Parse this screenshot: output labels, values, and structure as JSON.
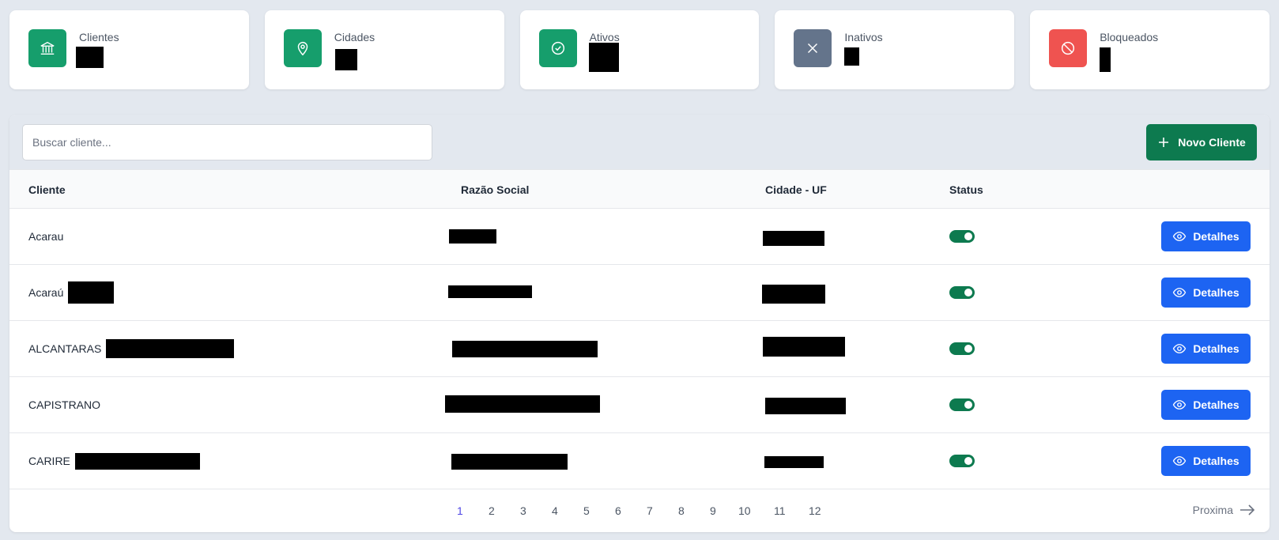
{
  "stats": [
    {
      "label": "Clientes",
      "icon": "bank-icon",
      "color": "#169e6c"
    },
    {
      "label": "Cidades",
      "icon": "map-pin-icon",
      "color": "#169e6c"
    },
    {
      "label": "Ativos",
      "icon": "check-circle-icon",
      "color": "#169e6c"
    },
    {
      "label": "Inativos",
      "icon": "x-icon",
      "color": "#64748b"
    },
    {
      "label": "Bloqueados",
      "icon": "ban-icon",
      "color": "#ef5350"
    }
  ],
  "search": {
    "placeholder": "Buscar cliente..."
  },
  "new_button": {
    "label": "Novo Cliente"
  },
  "table": {
    "headers": {
      "cliente": "Cliente",
      "razao": "Razão Social",
      "cidade": "Cidade - UF",
      "status": "Status"
    },
    "rows": [
      {
        "cliente": "Acarau",
        "status": "on",
        "action": "Detalhes"
      },
      {
        "cliente": "Acaraú",
        "status": "on",
        "action": "Detalhes"
      },
      {
        "cliente": "ALCANTARAS",
        "status": "on",
        "action": "Detalhes"
      },
      {
        "cliente": "CAPISTRANO",
        "status": "on",
        "action": "Detalhes"
      },
      {
        "cliente": "CARIRE",
        "status": "on",
        "action": "Detalhes"
      }
    ]
  },
  "pagination": {
    "pages": [
      "1",
      "2",
      "3",
      "4",
      "5",
      "6",
      "7",
      "8",
      "9",
      "10",
      "11",
      "12"
    ],
    "current": "1",
    "next_label": "Proxima"
  },
  "colors": {
    "primary_green": "#0d7a4f",
    "primary_blue": "#1d64f2",
    "background": "#e3e8ef"
  }
}
